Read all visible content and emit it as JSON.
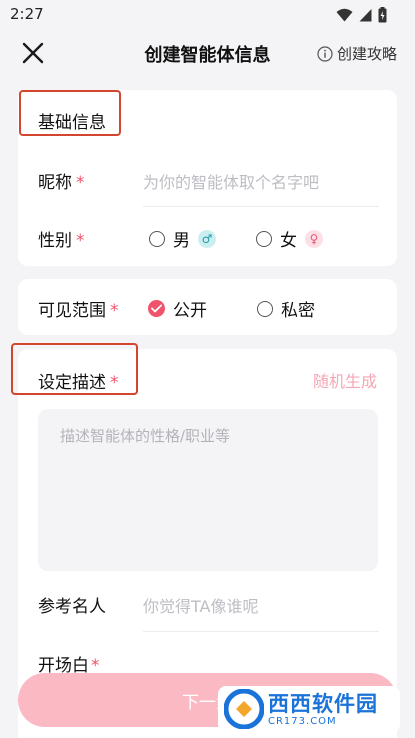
{
  "status": {
    "time": "2:27"
  },
  "nav": {
    "title": "创建智能体信息",
    "guide": "创建攻略"
  },
  "basic": {
    "section_title": "基础信息",
    "nickname_label": "昵称",
    "nickname_placeholder": "为你的智能体取个名字吧",
    "gender_label": "性别",
    "male": "男",
    "female": "女",
    "male_symbol": "♂",
    "female_symbol": "♀"
  },
  "visibility": {
    "label": "可见范围",
    "public": "公开",
    "private": "私密",
    "selected": "公开"
  },
  "setting": {
    "label": "设定描述",
    "random": "随机生成",
    "textarea_placeholder": "描述智能体的性格/职业等",
    "reference_label": "参考名人",
    "reference_placeholder": "你觉得TA像谁呢",
    "opening_label": "开场白"
  },
  "required_mark": "*",
  "next_button": "下一步",
  "watermark": {
    "main": "西西软件园",
    "sub": "CR173.COM"
  },
  "colors": {
    "accent": "#f0546c",
    "next_button": "#fbb9c4",
    "highlight": "#d2452e"
  }
}
